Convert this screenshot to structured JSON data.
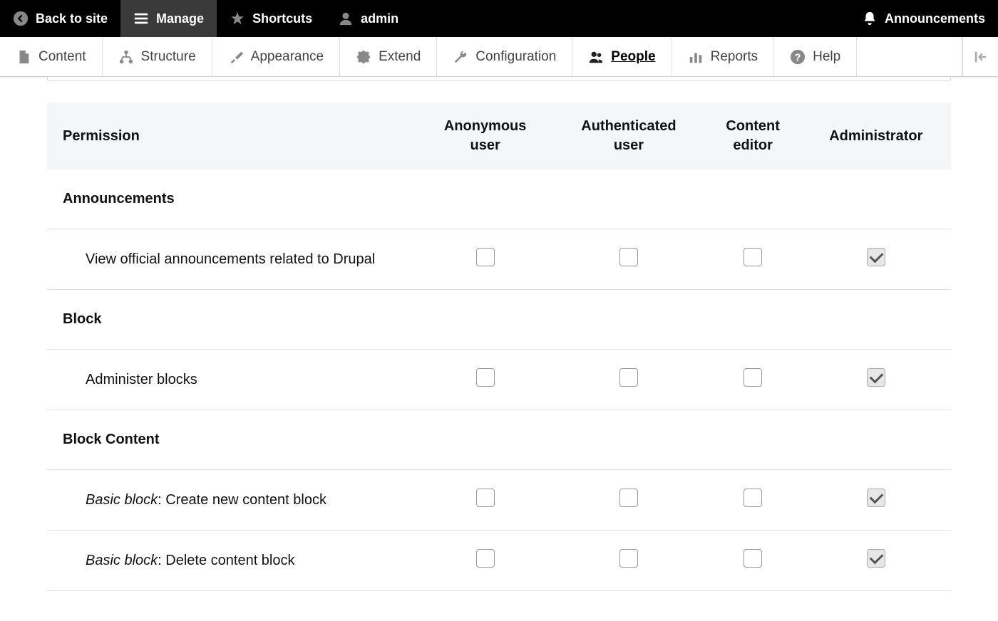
{
  "toolbar": {
    "back": "Back to site",
    "manage": "Manage",
    "shortcuts": "Shortcuts",
    "user": "admin",
    "announcements": "Announcements"
  },
  "adminNav": {
    "content": "Content",
    "structure": "Structure",
    "appearance": "Appearance",
    "extend": "Extend",
    "configuration": "Configuration",
    "people": "People",
    "reports": "Reports",
    "help": "Help",
    "active": "people"
  },
  "permissionsTable": {
    "header": {
      "permission": "Permission",
      "roles": [
        "Anonymous user",
        "Authenticated user",
        "Content editor",
        "Administrator"
      ]
    },
    "rows": [
      {
        "type": "group",
        "label": "Announcements"
      },
      {
        "type": "perm",
        "label": "View official announcements related to Drupal",
        "checks": [
          false,
          false,
          false,
          true
        ]
      },
      {
        "type": "group",
        "label": "Block"
      },
      {
        "type": "perm",
        "label": "Administer blocks",
        "checks": [
          false,
          false,
          false,
          true
        ]
      },
      {
        "type": "group",
        "label": "Block Content"
      },
      {
        "type": "perm",
        "labelPrefix": "Basic block",
        "labelSuffix": ": Create new content block",
        "checks": [
          false,
          false,
          false,
          true
        ]
      },
      {
        "type": "perm",
        "labelPrefix": "Basic block",
        "labelSuffix": ": Delete content block",
        "checks": [
          false,
          false,
          false,
          true
        ]
      }
    ]
  }
}
